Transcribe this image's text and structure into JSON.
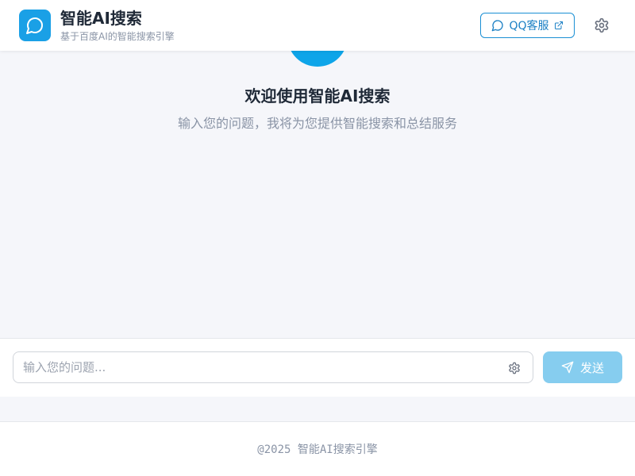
{
  "header": {
    "title": "智能AI搜索",
    "subtitle": "基于百度AI的智能搜索引擎",
    "logo_icon": "chat-bubble-icon",
    "support_button_label": "QQ客服",
    "support_button_icons": [
      "chat-bubble-icon",
      "external-link-icon"
    ],
    "settings_icon": "gear-icon"
  },
  "welcome": {
    "title": "欢迎使用智能AI搜索",
    "subtitle": "输入您的问题，我将为您提供智能搜索和总结服务"
  },
  "input_bar": {
    "placeholder": "输入您的问题...",
    "value": "",
    "settings_icon": "gear-icon",
    "send_label": "发送",
    "send_icon": "send-icon"
  },
  "footer": {
    "text": "@2025 智能AI搜索引擎"
  },
  "colors": {
    "brand": "#1aa0e6",
    "hero_circle": "#0ea5e9",
    "send_button_disabled": "#86cdef",
    "page_background": "#f5f6fa"
  }
}
